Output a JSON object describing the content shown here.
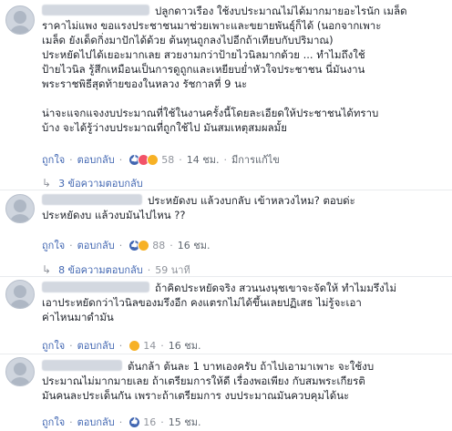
{
  "comments": [
    {
      "text": "ปลูกดาวเรือง ใช้งบประมาณไม่ได้มากมายอะไรนัก เมล็ด\nราคาไม่แพง ขอแรงประชาชนมาช่วยเพาะและขยายพันธุ์ก็ได้ (นอกจากเพาะ\nเมล็ด ยังเด็ดกิ่งมาปักได้ด้วย ต้นทุนถูกลงไปอีกถ้าเทียบกับปริมาณ)\nประหยัดไปได้เยอะมากเลย สวยงามกว่าป้ายไวนิลมากด้วย ... ทำไมถึงใช้\nป้ายไวนิล รู้สึกเหมือนเป็นการดูถูกและเหยียบย่ำหัวใจประชาชน นี่มันงาน\nพระราชพิธีสุดท้ายของในหลวง รัชกาลที่ 9 นะ\n\nน่าจะแจกแจงงบประมาณที่ใช้ในงานครั้งนี้โดยละเอียดให้ประชาชนได้ทราบ\nบ้าง จะได้รู้ว่างบประมาณที่ถูกใช้ไป มันสมเหตุสมผลมั้ย",
      "like": "ถูกใจ",
      "reply": "ตอบกลับ",
      "reactions": "58",
      "time": "14 ชม.",
      "edited": "มีการแก้ไข"
    },
    {
      "text": "ประหยัดงบ แล้วงบกลับ เข้าหลวงไหม? ตอบด่ะ\nประหยัดงบ แล้วงบมันไปไหน ??",
      "like": "ถูกใจ",
      "reply": "ตอบกลับ",
      "reactions": "88",
      "time": "16 ชม."
    },
    {
      "text": "ถ้าคิดประหยัดจริง สวนนงนุชเขาจะจัดให้ ทำไมมรึงไม่\nเอาประหยัดกว่าไวนิลของมรึงอีก คงแตรกไม่ได้ขึ้นเลยปฏิเสธ ไม่รู้จะเอา\nค่าไหนมาดำมัน",
      "like": "ถูกใจ",
      "reply": "ตอบกลับ",
      "reactions": "14",
      "time": "16 ชม."
    },
    {
      "text": "ต้นกล้า ต้นละ 1 บาทเองครับ ถ้าไปเอามาเพาะ จะใช้งบ\nประมาณไม่มากมายเลย ถ้าเตรียมการให้ดี เรื่องพอเพียง กับสมพระเกียรติ\nมันคนละประเด็นกัน เพราะถ้าเตรียมการ งบประมาณมันควบคุมได้นะ",
      "like": "ถูกใจ",
      "reply": "ตอบกลับ",
      "reactions": "16",
      "time": "15 ชม."
    }
  ],
  "reply_rows": [
    {
      "label": "3 ข้อความตอบกลับ",
      "time": ""
    },
    {
      "label": "8 ข้อความตอบกลับ",
      "time": "59 นาที"
    }
  ],
  "colors": {
    "link": "#4267b2",
    "muted": "#90949c",
    "text": "#1d2129"
  }
}
